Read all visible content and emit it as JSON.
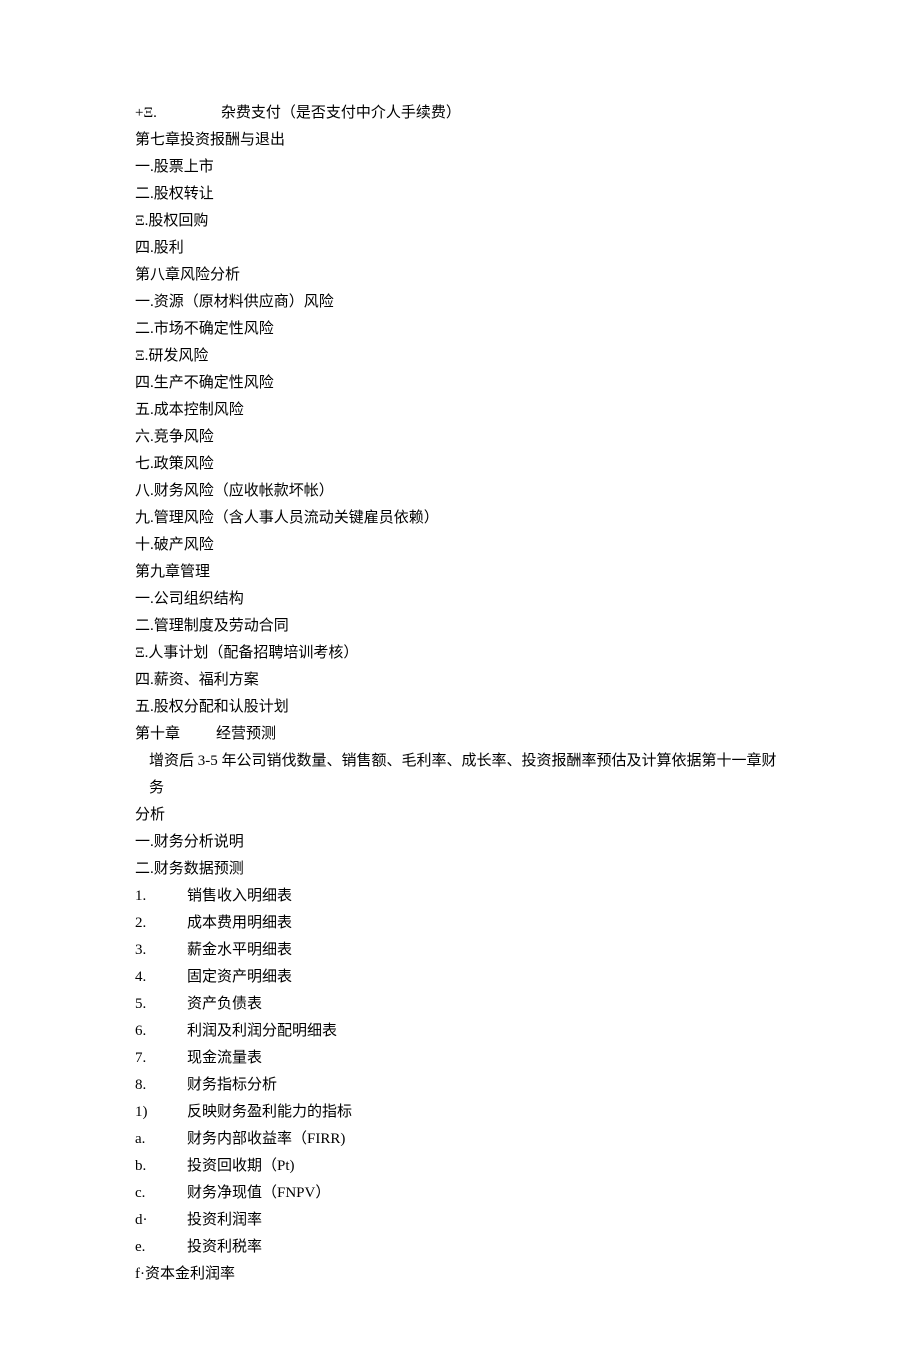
{
  "lines": [
    {
      "idx": "+Ξ.",
      "text": "杂费支付（是否支付中介人手续费）",
      "gap": "big"
    },
    {
      "text": "第七章投资报酬与退出"
    },
    {
      "text": "一.股票上市"
    },
    {
      "text": "二.股权转让"
    },
    {
      "text": "Ξ.股权回购"
    },
    {
      "text": "四.股利"
    },
    {
      "text": "第八章风险分析"
    },
    {
      "text": "一.资源（原材料供应商）风险"
    },
    {
      "text": "二.市场不确定性风险"
    },
    {
      "text": "Ξ.研发风险"
    },
    {
      "text": "四.生产不确定性风险"
    },
    {
      "text": "五.成本控制风险"
    },
    {
      "text": "六.竞争风险"
    },
    {
      "text": "七.政策风险"
    },
    {
      "text": "八.财务风险（应收帐款坏帐）"
    },
    {
      "text": "九.管理风险（含人事人员流动关键雇员依赖）"
    },
    {
      "text": "十.破产风险"
    },
    {
      "text": "第九章管理"
    },
    {
      "text": "一.公司组织结构"
    },
    {
      "text": "二.管理制度及劳动合同"
    },
    {
      "text": "Ξ.人事计划（配备招聘培训考核）"
    },
    {
      "text": "四.薪资、福利方案"
    },
    {
      "text": "五.股权分配和认股计划"
    },
    {
      "idx": "第十章",
      "text": "经营预测",
      "gap": "small"
    },
    {
      "text": "增资后 3-5 年公司销伐数量、销售额、毛利率、成长率、投资报酬率预估及计算依据第十一章财务",
      "indent": true
    },
    {
      "text": "分析"
    },
    {
      "text": "一.财务分析说明"
    },
    {
      "text": "二.财务数据预测"
    },
    {
      "idx": "1.",
      "text": "销售收入明细表",
      "col": true
    },
    {
      "idx": "2.",
      "text": "成本费用明细表",
      "col": true
    },
    {
      "idx": "3.",
      "text": "薪金水平明细表",
      "col": true
    },
    {
      "idx": "4.",
      "text": "固定资产明细表",
      "col": true
    },
    {
      "idx": "5.",
      "text": "资产负债表",
      "col": true
    },
    {
      "idx": "6.",
      "text": "利润及利润分配明细表",
      "col": true
    },
    {
      "idx": "7.",
      "text": "现金流量表",
      "col": true
    },
    {
      "idx": "8.",
      "text": "财务指标分析",
      "col": true
    },
    {
      "idx": "1)",
      "text": "反映财务盈利能力的指标",
      "col": true
    },
    {
      "idx": "a.",
      "text": "财务内部收益率（FIRR)",
      "col": true
    },
    {
      "idx": "b.",
      "text": "投资回收期（Pt)",
      "col": true
    },
    {
      "idx": "c.",
      "text": "财务净现值（FNPV）",
      "col": true
    },
    {
      "idx": "d·",
      "text": "投资利润率",
      "col": true
    },
    {
      "idx": "e.",
      "text": "投资利税率",
      "col": true
    },
    {
      "text": "f·资本金利润率"
    }
  ]
}
